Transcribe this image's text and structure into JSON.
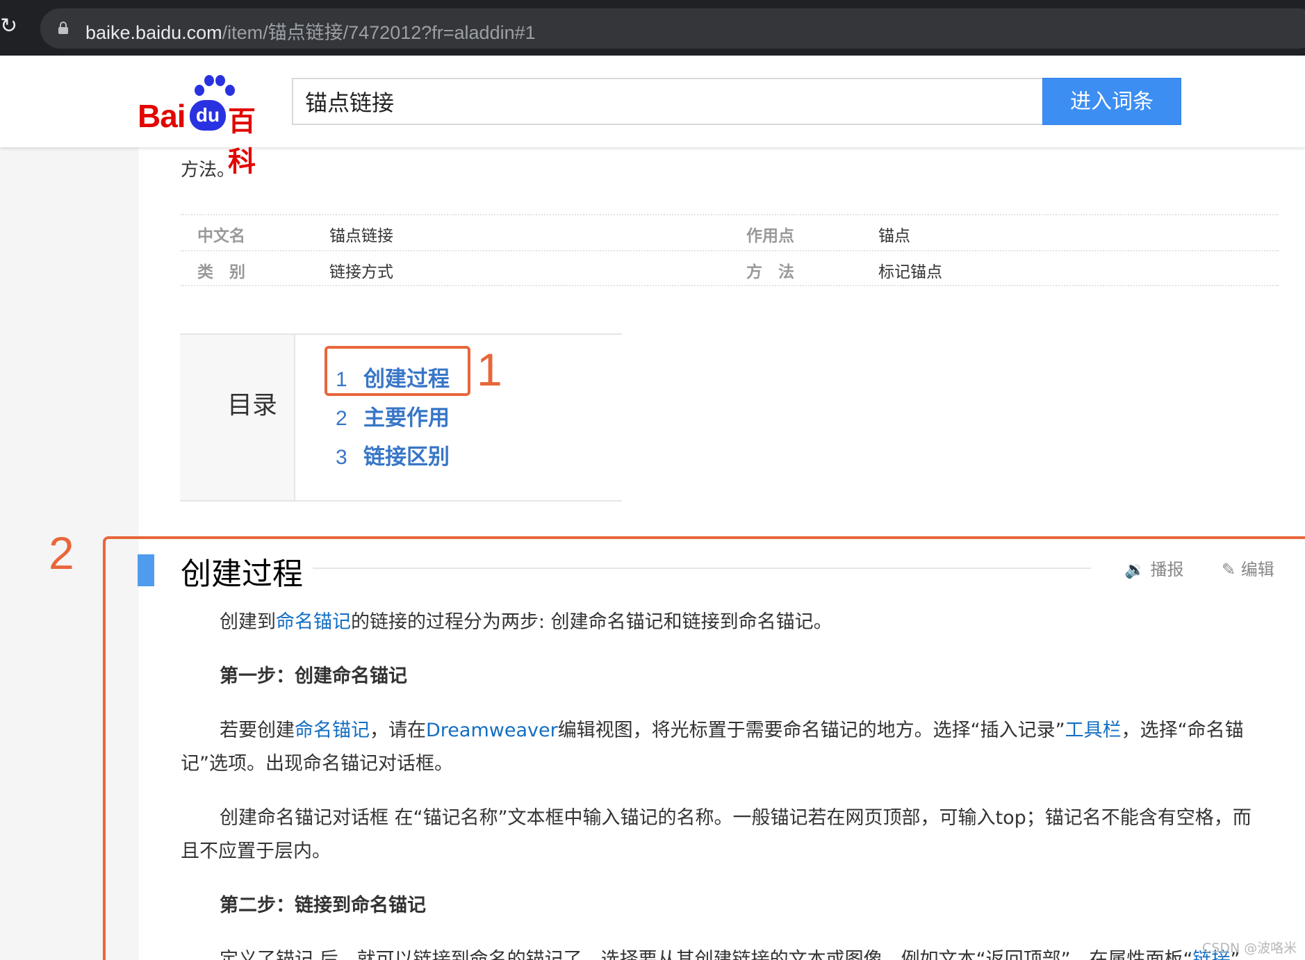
{
  "browser": {
    "url_host": "baike.baidu.com",
    "url_path": "/item/锚点链接/7472012?fr=aladdin#1"
  },
  "header": {
    "logo_bai": "Bai",
    "logo_du": "du",
    "logo_baike": "百科",
    "search_value": "锚点链接",
    "search_button": "进入词条"
  },
  "intro_tail": "方法。",
  "basic_info": [
    {
      "name": "中文名",
      "value": "锚点链接",
      "name2": "作用点",
      "value2": "锚点"
    },
    {
      "name": "类　别",
      "value": "链接方式",
      "name2": "方　法",
      "value2": "标记锚点"
    }
  ],
  "toc": {
    "label": "目录",
    "items": [
      {
        "num": "1",
        "text": "创建过程"
      },
      {
        "num": "2",
        "text": "主要作用"
      },
      {
        "num": "3",
        "text": "链接区别"
      }
    ]
  },
  "section": {
    "title": "创建过程",
    "play_label": "播报",
    "edit_label": "编辑",
    "p1_a": "创建到",
    "p1_link": "命名锚记",
    "p1_b": "的链接的过程分为两步: 创建命名锚记和链接到命名锚记。",
    "step1": "第一步：创建命名锚记",
    "p2_a": "若要创建",
    "p2_link1": "命名锚记",
    "p2_b": "，请在",
    "p2_link2": "Dreamweaver",
    "p2_c": "编辑视图，将光标置于需要命名锚记的地方。选择“插入记录”",
    "p2_link3": "工具栏",
    "p2_d": "，选择“命名锚记”选项。出现命名锚记对话框。",
    "p3": "创建命名锚记对话框 在“锚记名称”文本框中输入锚记的名称。一般锚记若在网页顶部，可输入top；锚记名不能含有空格，而且不应置于层内。",
    "step2": "第二步：链接到命名锚记",
    "p4_a": "定义了锚记 后，就可以链接到命名的锚记了。选择要从其创建链接的文本或图像，例如文本“返回顶部”，在属性面板“",
    "p4_link": "链接",
    "p4_b": "”"
  },
  "annotations": {
    "label1": "1",
    "label2": "2",
    "color": "#e8663a"
  },
  "watermark": "CSDN @波咯米"
}
